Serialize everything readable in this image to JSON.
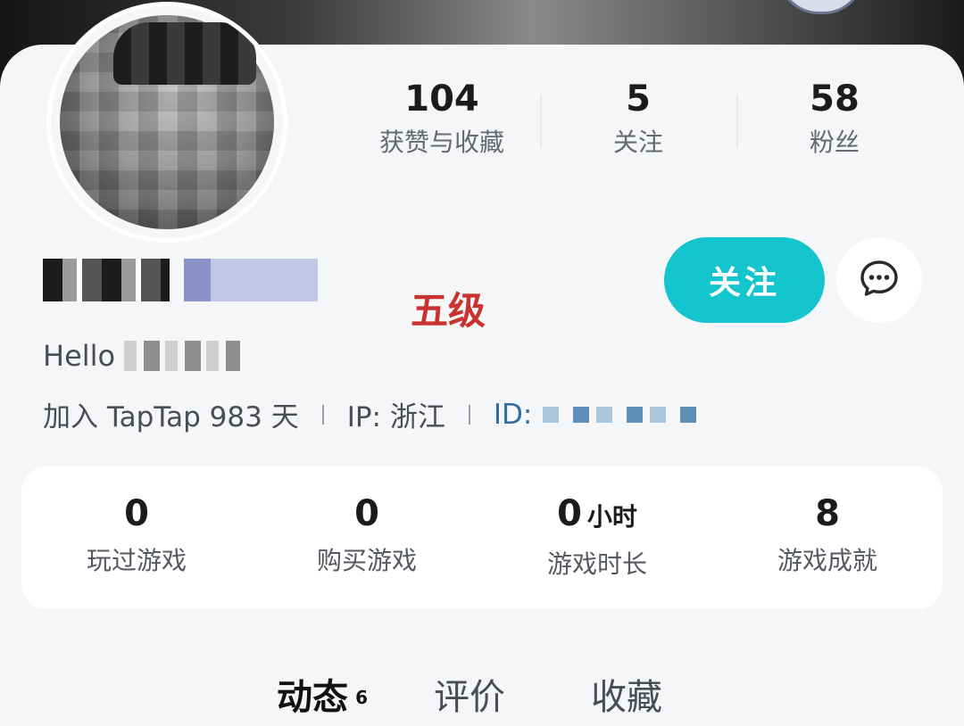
{
  "profile": {
    "stats": [
      {
        "value": "104",
        "label": "获赞与收藏"
      },
      {
        "value": "5",
        "label": "关注"
      },
      {
        "value": "58",
        "label": "粉丝"
      }
    ],
    "level_annotation": "五级",
    "follow_label": "关注",
    "bio_prefix": "Hello",
    "meta": {
      "joined": "加入 TapTap 983 天",
      "ip": "IP:  浙江",
      "id_prefix": "ID:"
    }
  },
  "game_stats": [
    {
      "value": "0",
      "unit": "",
      "label": "玩过游戏"
    },
    {
      "value": "0",
      "unit": "",
      "label": "购买游戏"
    },
    {
      "value": "0",
      "unit": "小时",
      "label": "游戏时长"
    },
    {
      "value": "8",
      "unit": "",
      "label": "游戏成就"
    }
  ],
  "tabs": [
    {
      "label": "动态",
      "count": "6"
    },
    {
      "label": "评价"
    },
    {
      "label": "收藏"
    }
  ],
  "colors": {
    "accent": "#15c5ce",
    "level_red": "#c9322f",
    "id_blue": "#2f6fa0"
  },
  "icons": {
    "message": "chat-bubble-icon"
  }
}
